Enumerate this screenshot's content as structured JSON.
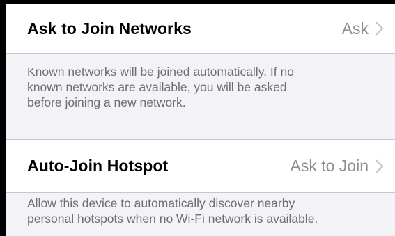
{
  "settings": {
    "ask_to_join": {
      "label": "Ask to Join Networks",
      "value": "Ask",
      "footer": "Known networks will be joined automatically. If no\nknown networks are available, you will be asked\nbefore joining a new network."
    },
    "auto_join_hotspot": {
      "label": "Auto-Join Hotspot",
      "value": "Ask to Join",
      "footer": "Allow this device to automatically discover nearby\npersonal hotspots when no Wi-Fi network is available."
    }
  },
  "icons": {
    "chevron": "chevron-right-icon"
  },
  "colors": {
    "background_grouped": "#f2f2f7",
    "cell": "#ffffff",
    "secondary_text": "#8e8e93",
    "footer_text": "#6d6d72"
  }
}
